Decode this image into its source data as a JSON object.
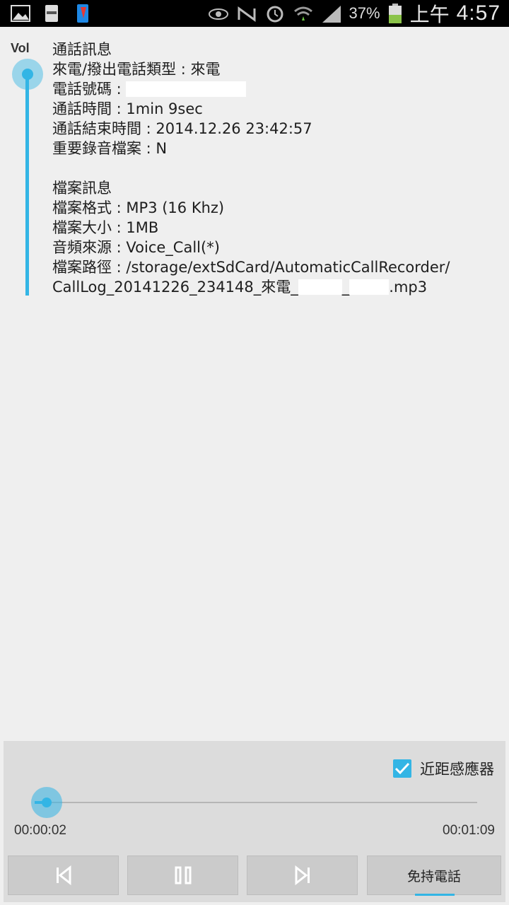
{
  "status_bar": {
    "battery": "37%",
    "ampm": "上午",
    "time": "4:57",
    "icons": [
      "gallery-icon",
      "galaxy-icon",
      "phone-app-icon",
      "eye-icon",
      "no-signal-icon",
      "alarm-icon",
      "wifi-icon",
      "signal-icon",
      "battery-icon"
    ]
  },
  "volume": {
    "label": "Vol",
    "level": 1.0
  },
  "call_info": {
    "heading": "通話訊息",
    "call_type": "來電/撥出電話類型 : 來電",
    "phone_number_label": "電話號碼 :",
    "duration": "通話時間 : 1min 9sec",
    "end_time": "通話結束時間 : 2014.12.26 23:42:57",
    "important": "重要錄音檔案 : N"
  },
  "file_info": {
    "heading": "檔案訊息",
    "format": "檔案格式 : MP3 (16 Khz)",
    "size": "檔案大小 : 1MB",
    "source": "音頻來源 : Voice_Call(*)",
    "path_line1": "檔案路徑 : /storage/extSdCard/AutomaticCallRecorder/",
    "path_prefix": "CallLog_20141226_234148_來電_",
    "path_mid": "_",
    "path_suffix": ".mp3"
  },
  "player": {
    "proximity_label": "近距感應器",
    "proximity_checked": true,
    "current_time": "00:00:02",
    "total_time": "00:01:09",
    "progress": 0.03,
    "speaker_label": "免持電話"
  },
  "colors": {
    "accent": "#33b5e5",
    "background": "#efefef",
    "panel": "#dcdcdc"
  }
}
